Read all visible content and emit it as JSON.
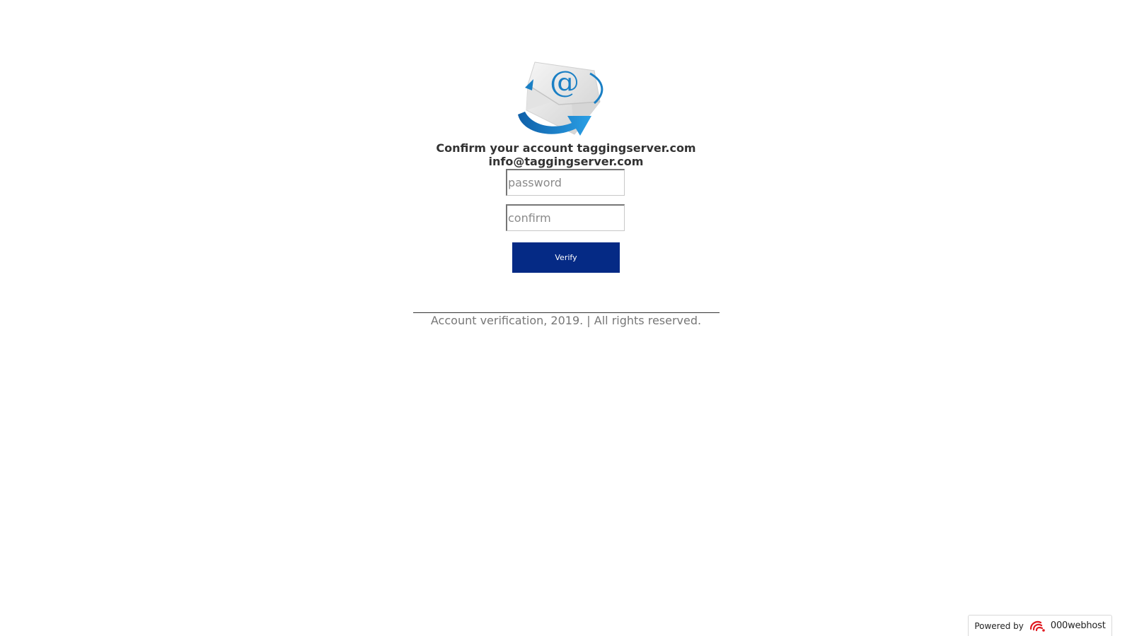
{
  "logo": {
    "icon": "email-envelope-at-icon"
  },
  "heading": {
    "line1": "Confirm your account  taggingserver.com",
    "line2": "info@taggingserver.com"
  },
  "form": {
    "password_placeholder": "password",
    "confirm_placeholder": "confirm",
    "verify_label": "Verify"
  },
  "footer": {
    "text": "Account verification, 2019. | All rights reserved."
  },
  "powered_by": {
    "label": "Powered by",
    "brand": "000webhost",
    "icon": "000webhost-logo-icon"
  },
  "colors": {
    "button_bg": "#052a85",
    "heading": "#333333",
    "footer_text": "#777777",
    "logo_blue": "#1a7fc4",
    "brand_red": "#e11b22"
  }
}
